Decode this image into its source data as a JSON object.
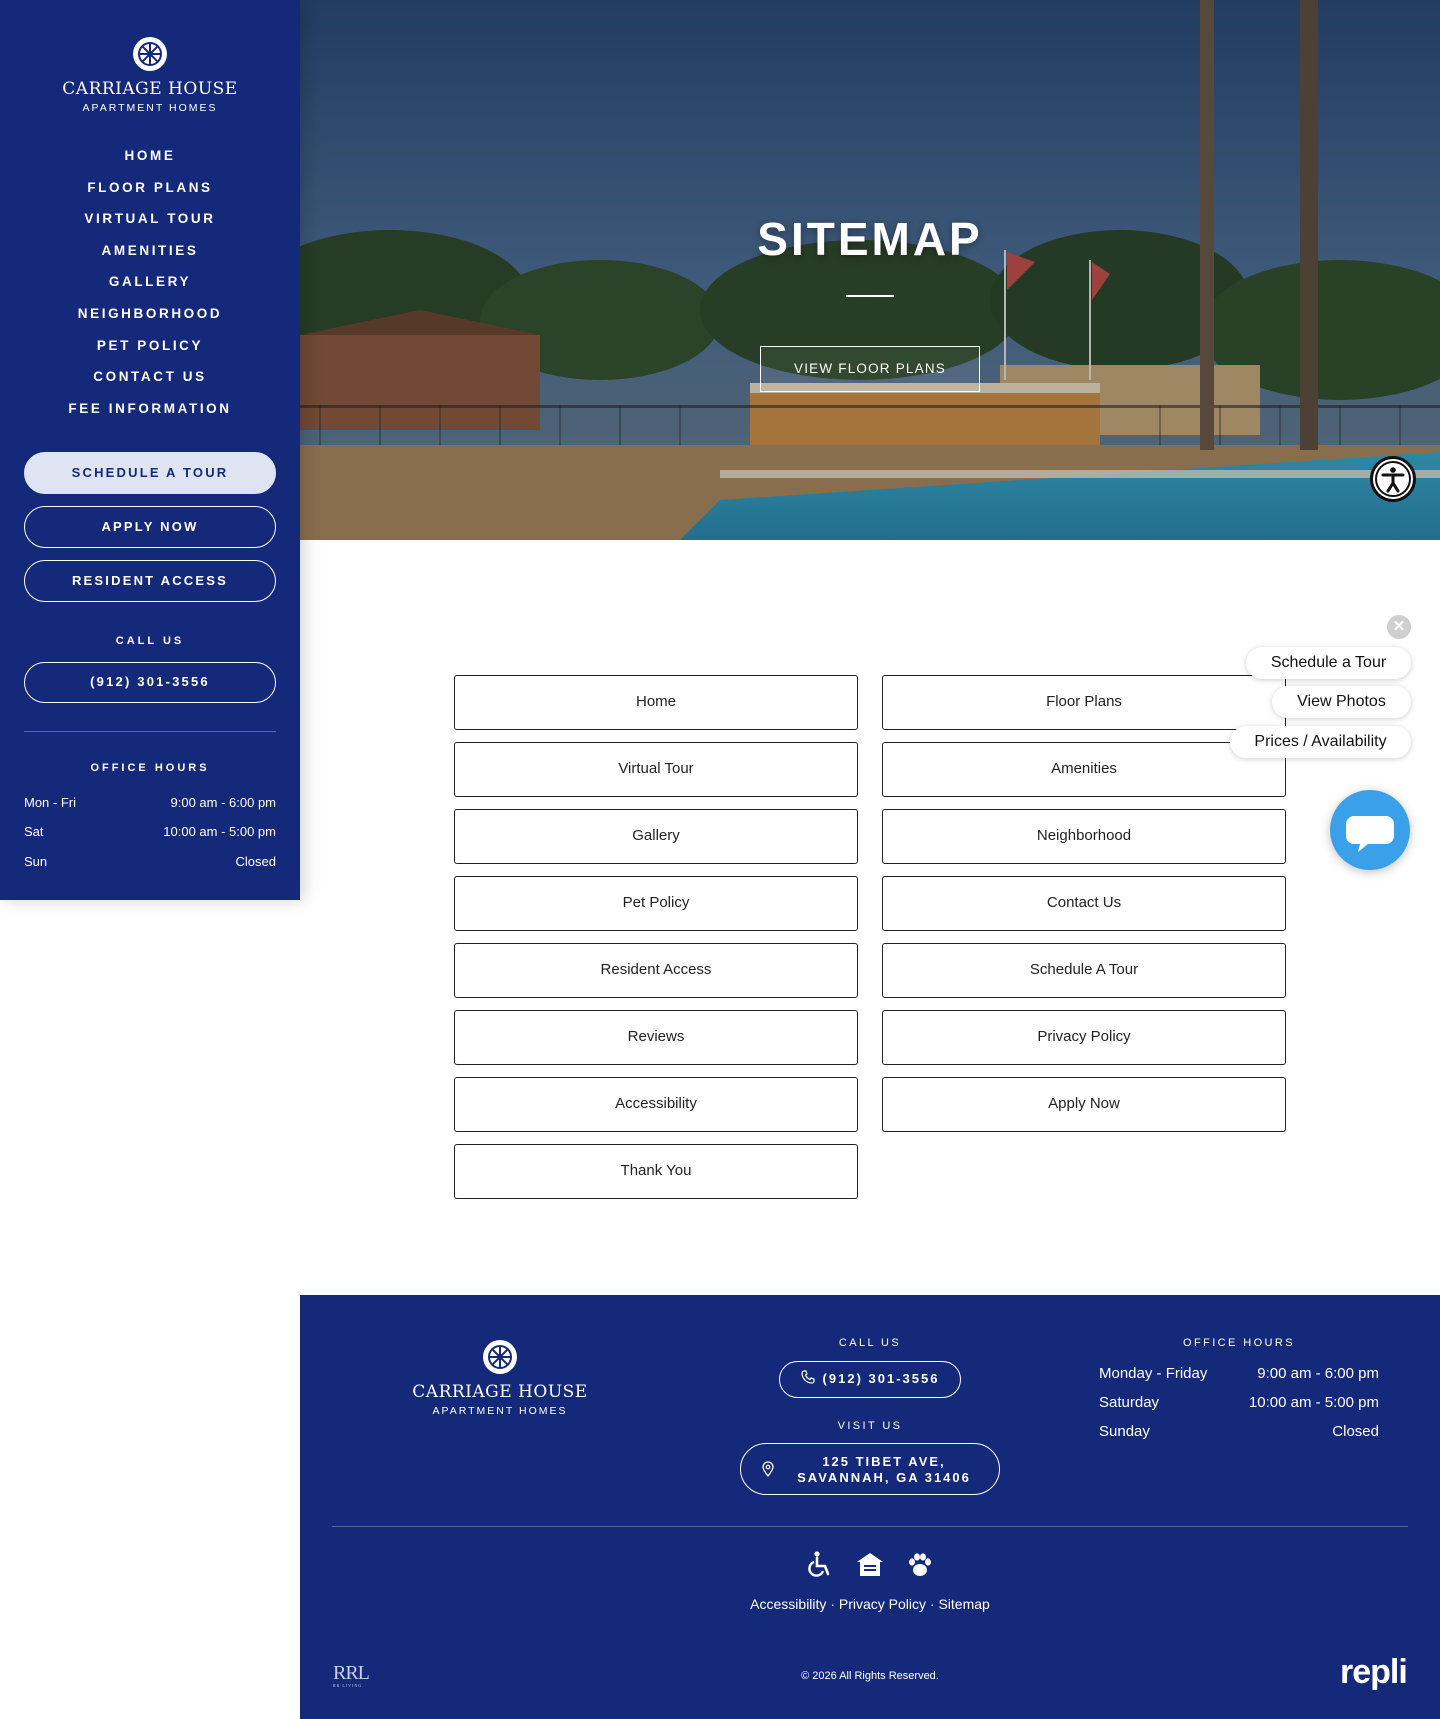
{
  "brand": {
    "name": "CARRIAGE HOUSE",
    "sub": "APARTMENT HOMES"
  },
  "sidebar": {
    "nav": [
      "HOME",
      "FLOOR PLANS",
      "VIRTUAL TOUR",
      "AMENITIES",
      "GALLERY",
      "NEIGHBORHOOD",
      "PET POLICY",
      "CONTACT US",
      "FEE INFORMATION"
    ],
    "schedule_label": "SCHEDULE A TOUR",
    "apply_label": "APPLY NOW",
    "resident_label": "RESIDENT ACCESS",
    "call_label": "CALL US",
    "phone": "(912) 301-3556",
    "hours_label": "OFFICE HOURS",
    "hours": [
      {
        "day": "Mon - Fri",
        "time": "9:00 am - 6:00 pm"
      },
      {
        "day": "Sat",
        "time": "10:00 am - 5:00 pm"
      },
      {
        "day": "Sun",
        "time": "Closed"
      }
    ]
  },
  "hero": {
    "title": "SITEMAP",
    "button": "VIEW FLOOR PLANS"
  },
  "sitemap": {
    "left": [
      "Home",
      "Virtual Tour",
      "Gallery",
      "Pet Policy",
      "Resident Access",
      "Reviews",
      "Accessibility",
      "Thank You"
    ],
    "right": [
      "Floor Plans",
      "Amenities",
      "Neighborhood",
      "Contact Us",
      "Schedule A Tour",
      "Privacy Policy",
      "Apply Now"
    ]
  },
  "widget": {
    "close": "✕",
    "options": [
      "Schedule a Tour",
      "View Photos",
      "Prices / Availability"
    ]
  },
  "footer": {
    "call_label": "CALL US",
    "phone": "(912) 301-3556",
    "visit_label": "VISIT US",
    "address_line1": "125 TIBET AVE,",
    "address_line2": "SAVANNAH, GA 31406",
    "hours_label": "OFFICE HOURS",
    "hours": [
      {
        "day": "Monday - Friday",
        "time": "9:00 am - 6:00 pm"
      },
      {
        "day": "Saturday",
        "time": "10:00 am - 5:00 pm"
      },
      {
        "day": "Sunday",
        "time": "Closed"
      }
    ],
    "links": [
      "Accessibility",
      "Privacy Policy",
      "Sitemap"
    ],
    "separator": "·",
    "copyright": "© 2026 All Rights Reserved.",
    "rrl_logo": "RRL",
    "rrl_sub": "RR LIVING",
    "repli_logo": "repli"
  },
  "icons": {
    "brand_mark": "wheel-logo-icon",
    "accessibility": "accessibility-person-icon",
    "chat": "chat-bubble-icon",
    "phone": "phone-icon",
    "map_pin": "map-pin-icon",
    "wheelchair": "wheelchair-icon",
    "equal_housing": "equal-housing-icon",
    "pet": "paw-icon"
  },
  "colors": {
    "primary": "#15297a",
    "button_light": "#dfe4f2",
    "chat": "#3aa0ea"
  }
}
